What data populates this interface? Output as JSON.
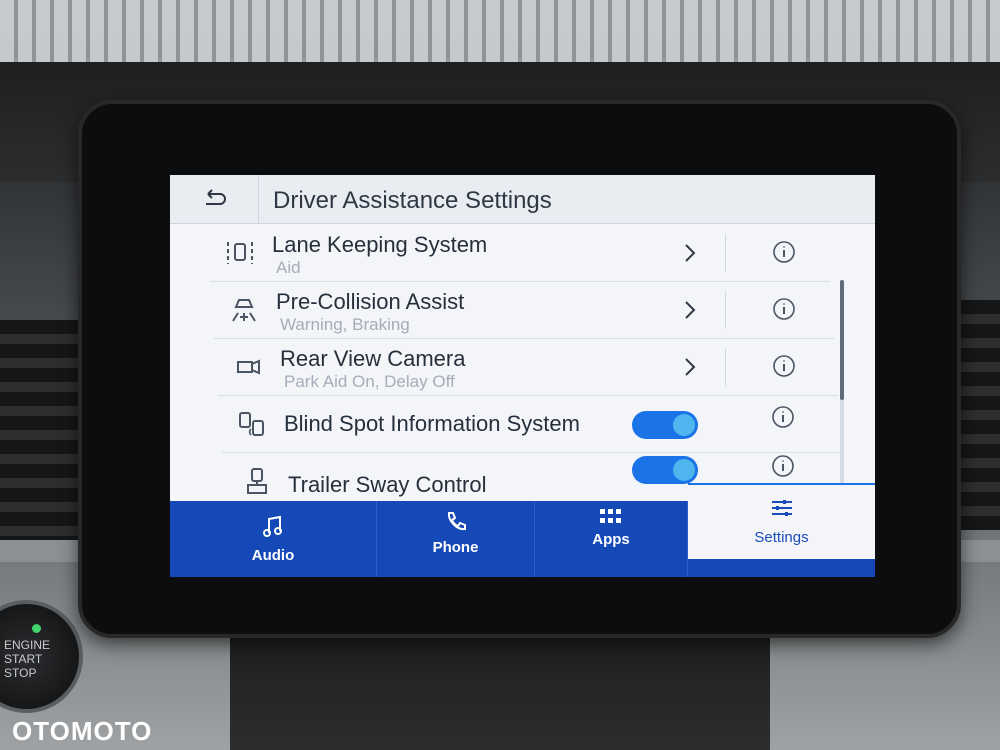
{
  "header": {
    "title": "Driver Assistance Settings"
  },
  "settings": [
    {
      "label": "Lane Keeping System",
      "sub": "Aid",
      "control": "chevron",
      "icon": "lane-keeping-icon"
    },
    {
      "label": "Pre-Collision Assist",
      "sub": "Warning, Braking",
      "control": "chevron",
      "icon": "pre-collision-icon"
    },
    {
      "label": "Rear View Camera",
      "sub": "Park Aid On, Delay Off",
      "control": "chevron",
      "icon": "rear-camera-icon"
    },
    {
      "label": "Blind Spot Information System",
      "sub": "",
      "control": "toggle",
      "toggle_on": true,
      "icon": "blind-spot-icon"
    },
    {
      "label": "Trailer Sway Control",
      "sub": "",
      "control": "toggle",
      "toggle_on": true,
      "icon": "trailer-sway-icon"
    }
  ],
  "nav": {
    "tabs": [
      {
        "label": "Audio",
        "icon": "music-note-icon",
        "active": false
      },
      {
        "label": "Phone",
        "icon": "phone-icon",
        "active": false
      },
      {
        "label": "Apps",
        "icon": "apps-grid-icon",
        "active": false
      },
      {
        "label": "Settings",
        "icon": "sliders-icon",
        "active": true
      }
    ]
  },
  "car": {
    "engine_button": "ENGINE\nSTART\nSTOP"
  },
  "watermark": "OTOMOTO",
  "colors": {
    "accent": "#1b73e8",
    "nav_bg": "#1549b8",
    "screen_bg": "#f3f5f8"
  }
}
